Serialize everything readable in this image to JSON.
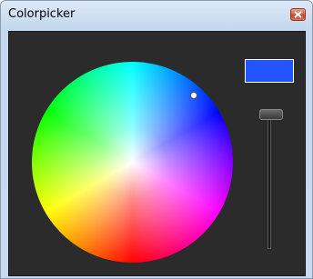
{
  "window": {
    "title": "Colorpicker"
  },
  "color_picker": {
    "selected_color": "#2255ff",
    "value_level": 1.0
  }
}
